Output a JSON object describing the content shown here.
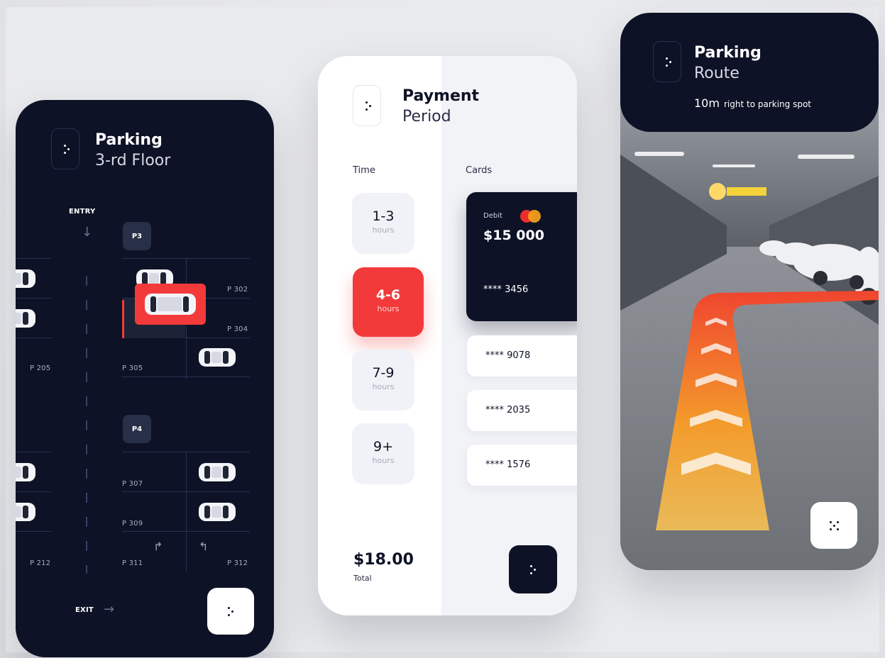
{
  "parking_map": {
    "title": "Parking",
    "subtitle": "3-rd Floor",
    "entry_label": "ENTRY",
    "exit_label": "EXIT",
    "zone_p3": "P3",
    "zone_p4": "P4",
    "spots": {
      "p302": "P 302",
      "p304": "P 304",
      "p205": "P 205",
      "p305": "P 305",
      "p307": "P 307",
      "p309": "P 309",
      "p212": "P 212",
      "p311": "P 311",
      "p312": "P 312"
    },
    "colors": {
      "background": "#0d1226",
      "accent": "#f23a3a"
    }
  },
  "payment": {
    "title": "Payment",
    "subtitle": "Period",
    "time_label": "Time",
    "cards_label": "Cards",
    "time_options": [
      {
        "range": "1-3",
        "unit": "hours"
      },
      {
        "range": "4-6",
        "unit": "hours"
      },
      {
        "range": "7-9",
        "unit": "hours"
      },
      {
        "range": "9+",
        "unit": "hours"
      }
    ],
    "selected_card": {
      "type": "Debit",
      "balance": "$15 000",
      "number": "**** 3456"
    },
    "other_cards": [
      "**** 9078",
      "**** 2035",
      "**** 1576"
    ],
    "total_value": "$18.00",
    "total_label": "Total"
  },
  "route": {
    "title": "Parking",
    "subtitle": "Route",
    "distance": "10m",
    "instruction": "right to parking spot"
  }
}
